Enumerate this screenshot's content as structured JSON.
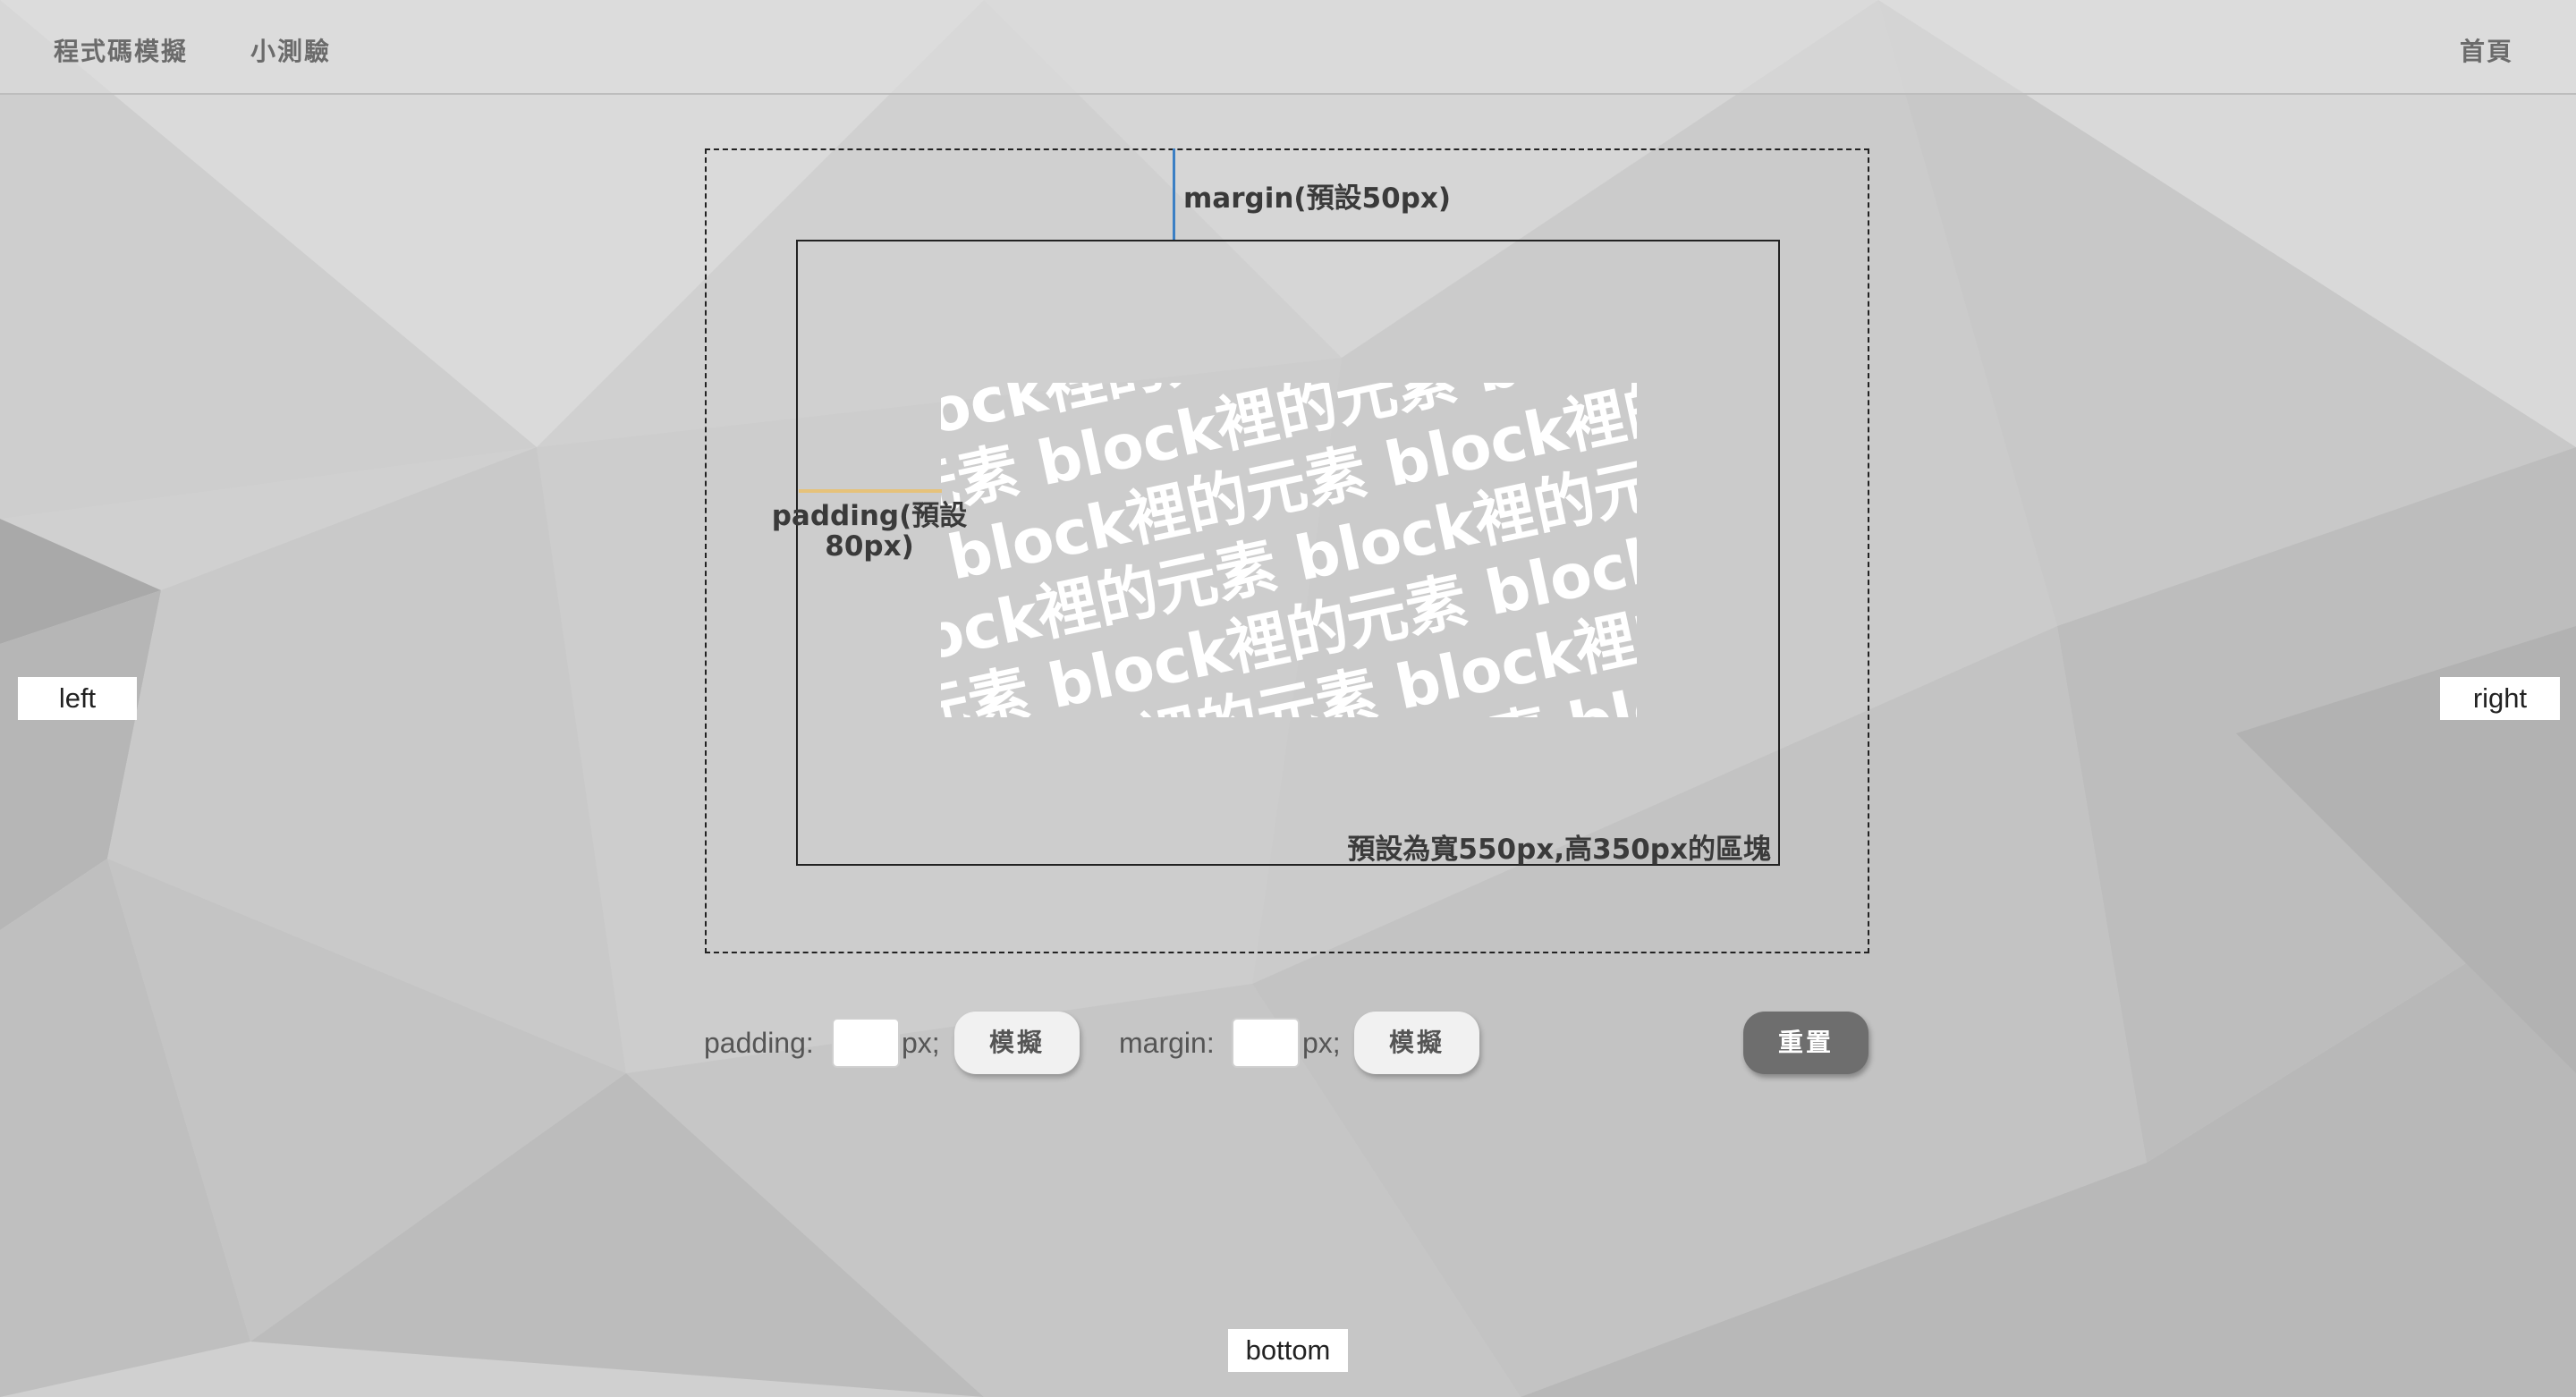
{
  "nav": {
    "simulation": "程式碼模擬",
    "quiz": "小測驗",
    "home": "首頁"
  },
  "markers": {
    "left": "left",
    "right": "right",
    "bottom": "bottom"
  },
  "diagram": {
    "margin_note": "margin(預設50px)",
    "padding_note_line1": "padding(預設",
    "padding_note_line2": "80px)",
    "block_note": "預設為寬550px,高350px的區塊",
    "content_text": "block裡的元素 block裡的元素 block裡的元素 block裡的元素 block裡的元素"
  },
  "controls": {
    "padding_label": "padding:",
    "padding_value": "",
    "padding_unit": "px;",
    "padding_button": "模擬",
    "margin_label": "margin:",
    "margin_value": "",
    "margin_unit": "px;",
    "margin_button": "模擬",
    "reset_button": "重置"
  },
  "colors": {
    "margin_indicator": "#3b7fc4",
    "padding_indicator": "#e6c27a",
    "reset_button": "#6e6e6e"
  }
}
